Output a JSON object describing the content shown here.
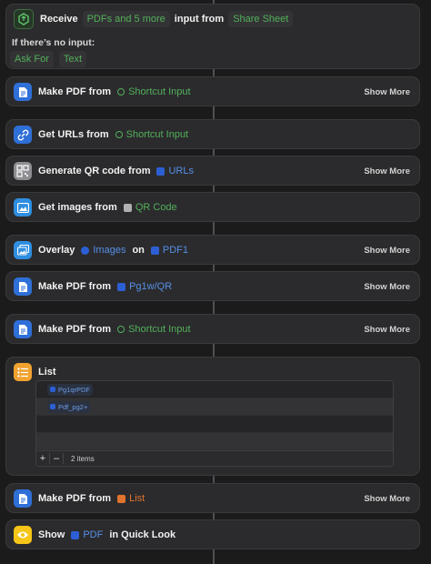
{
  "receive": {
    "label": "Receive",
    "types": "PDFs and 5 more",
    "middle": "input from",
    "source": "Share Sheet",
    "no_input_label": "If there’s no input:",
    "ask_for": "Ask For",
    "ask_type": "Text"
  },
  "actions": [
    {
      "prefix": "Make PDF from",
      "token": "Shortcut Input",
      "more": "Show More"
    },
    {
      "prefix": "Get URLs from",
      "token": "Shortcut Input"
    },
    {
      "prefix": "Generate QR code from",
      "token": "URLs",
      "more": "Show More"
    },
    {
      "prefix": "Get images from",
      "token": "QR Code"
    },
    {
      "prefix": "Overlay",
      "token": "Images",
      "mid": "on",
      "token2": "PDF1",
      "more": "Show More"
    },
    {
      "prefix": "Make PDF from",
      "token": "Pg1w/QR",
      "more": "Show More"
    },
    {
      "prefix": "Make PDF from",
      "token": "Shortcut Input",
      "more": "Show More"
    },
    {
      "prefix": "List"
    },
    {
      "prefix": "Make PDF from",
      "token": "List",
      "more": "Show More"
    },
    {
      "prefix": "Show",
      "token": "PDF",
      "suffix": "in Quick Look"
    }
  ],
  "list": {
    "items": [
      "Pg1qrPDF",
      "Pdf_pg2+"
    ],
    "add": "+",
    "remove": "–",
    "count": "2 items"
  },
  "colors": {
    "background": "#1b1b1c",
    "card": "#2b2b2d",
    "green_token": "#52b05a",
    "blue_token": "#5690e8",
    "orange_token": "#e0732e",
    "pdf_icon": "#2f6fd8",
    "list_icon": "#f1a22f",
    "show_icon": "#f5c518"
  },
  "icons": {
    "receive": "share-sheet-icon",
    "make_pdf": "document-icon",
    "get_urls": "link-icon",
    "qr": "qr-code-icon",
    "get_images": "image-icon",
    "overlay": "overlay-image-icon",
    "list": "list-icon",
    "show": "eye-icon"
  }
}
